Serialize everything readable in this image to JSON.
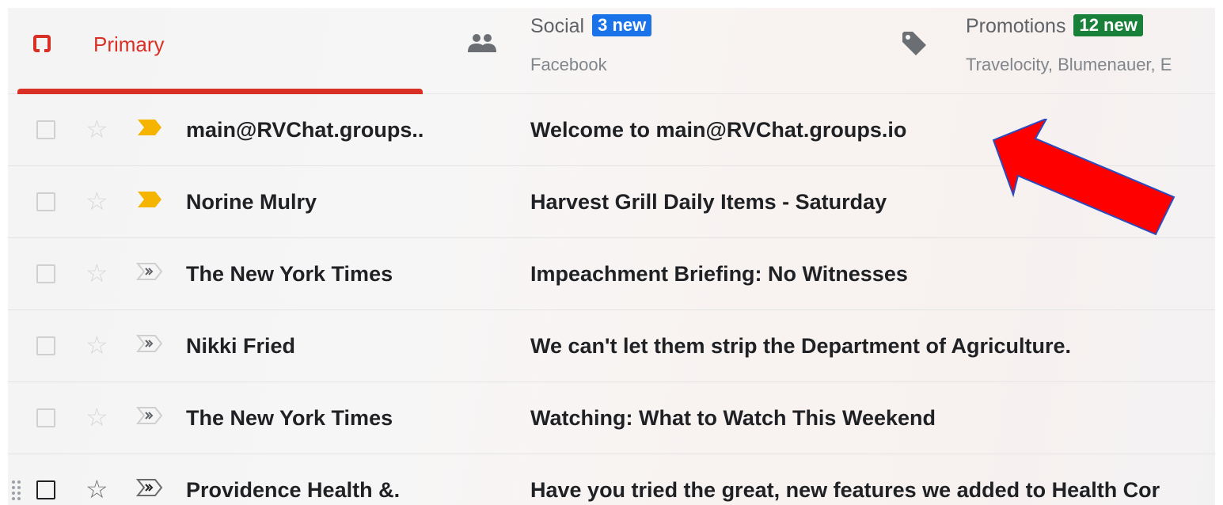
{
  "tabs": {
    "primary": {
      "label": "Primary"
    },
    "social": {
      "label": "Social",
      "badge": "3 new",
      "subtitle": "Facebook"
    },
    "promotions": {
      "label": "Promotions",
      "badge": "12 new",
      "subtitle": "Travelocity, Blumenauer, E"
    }
  },
  "emails": [
    {
      "sender": "main@RVChat.groups..",
      "subject": "Welcome to main@RVChat.groups.io",
      "important": "marked"
    },
    {
      "sender": "Norine Mulry",
      "subject": "Harvest Grill Daily Items - Saturday",
      "important": "marked"
    },
    {
      "sender": "The New York Times",
      "subject": "Impeachment Briefing: No Witnesses",
      "important": "auto"
    },
    {
      "sender": "Nikki Fried",
      "subject": "We can't let them strip the Department of Agriculture.",
      "important": "auto"
    },
    {
      "sender": "The New York Times",
      "subject": "Watching: What to Watch This Weekend",
      "important": "auto"
    },
    {
      "sender": "Providence Health &.",
      "subject": "Have you tried the great, new features we added to Health Cor",
      "important": "auto"
    }
  ],
  "colors": {
    "primary_accent": "#d93025",
    "social_badge": "#1a73e8",
    "promotions_badge": "#188038",
    "importance_marker": "#f4b400",
    "annotation_arrow": "#ff0000"
  },
  "icons": {
    "primary": "inbox-icon",
    "social": "people-icon",
    "promotions": "tag-icon",
    "star": "star-outline-icon",
    "importance": "importance-marker-icon"
  }
}
